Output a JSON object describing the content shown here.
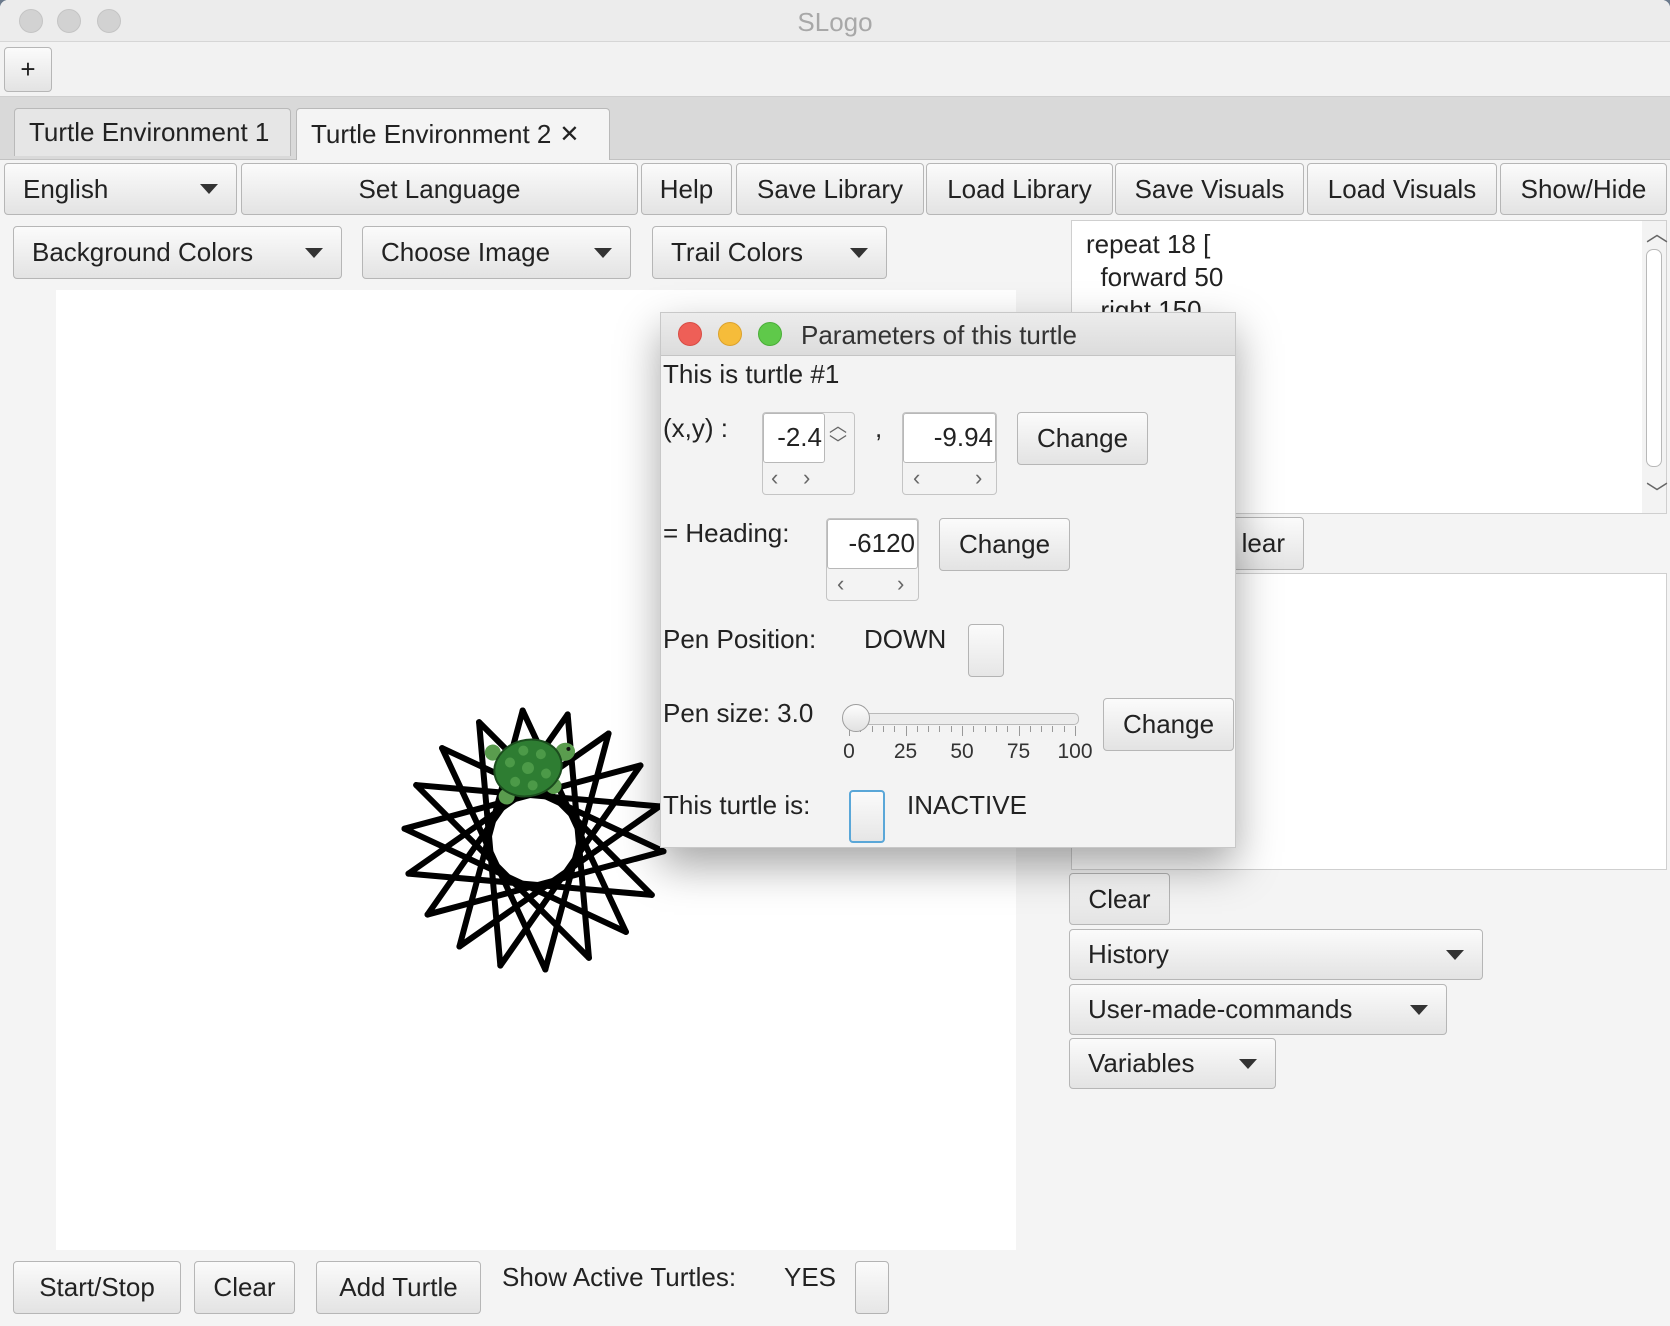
{
  "window": {
    "title": "SLogo"
  },
  "toolbar_top": {
    "add_label": "+"
  },
  "tabs": [
    {
      "label": "Turtle Environment 1",
      "active": false
    },
    {
      "label": "Turtle Environment 2",
      "active": true,
      "close": "✕"
    }
  ],
  "menu": {
    "language_value": "English",
    "set_language": "Set Language",
    "help": "Help",
    "save_library": "Save Library",
    "load_library": "Load Library",
    "save_visuals": "Save Visuals",
    "load_visuals": "Load Visuals",
    "show_hide": "Show/Hide"
  },
  "canvas_controls": {
    "background_colors": "Background Colors",
    "choose_image": "Choose Image",
    "trail_colors": "Trail Colors"
  },
  "editor": {
    "lines": [
      "repeat 18 [",
      "  forward 50",
      "  right 150"
    ],
    "clear_partial": "lear"
  },
  "right_panel": {
    "clear": "Clear",
    "history": "History",
    "user_commands": "User-made-commands",
    "variables": "Variables"
  },
  "bottom_bar": {
    "start_stop": "Start/Stop",
    "clear": "Clear",
    "add_turtle": "Add Turtle",
    "show_active_label": "Show Active Turtles:",
    "show_active_value": "YES"
  },
  "dialog": {
    "title": "Parameters of this turtle",
    "turtle_id": "This is turtle #1",
    "xy_label": "(x,y) :",
    "x_value": "-2.4",
    "comma": ",",
    "y_value": "-9.94",
    "change": "Change",
    "heading_label": "= Heading:",
    "heading_value": "-6120",
    "pen_position_label": "Pen Position:",
    "pen_position_value": "DOWN",
    "pen_size_label": "Pen size: 3.0",
    "pen_size_value": 3.0,
    "slider_min": 0,
    "slider_max": 100,
    "slider_ticks": [
      "0",
      "25",
      "50",
      "75",
      "100"
    ],
    "active_label": "This turtle is:",
    "active_value": "INACTIVE"
  },
  "colors": {
    "close": "#ee5f57",
    "minimize": "#f6bc3a",
    "maximize": "#5fc94a",
    "trail": "#000000",
    "turtle_shell": "#2e7d32",
    "focus": "#5aa7d8"
  },
  "icons": [
    "dropdown-triangle-icon",
    "close-tab-icon",
    "spinner-arrow-icon",
    "turtle-icon"
  ]
}
